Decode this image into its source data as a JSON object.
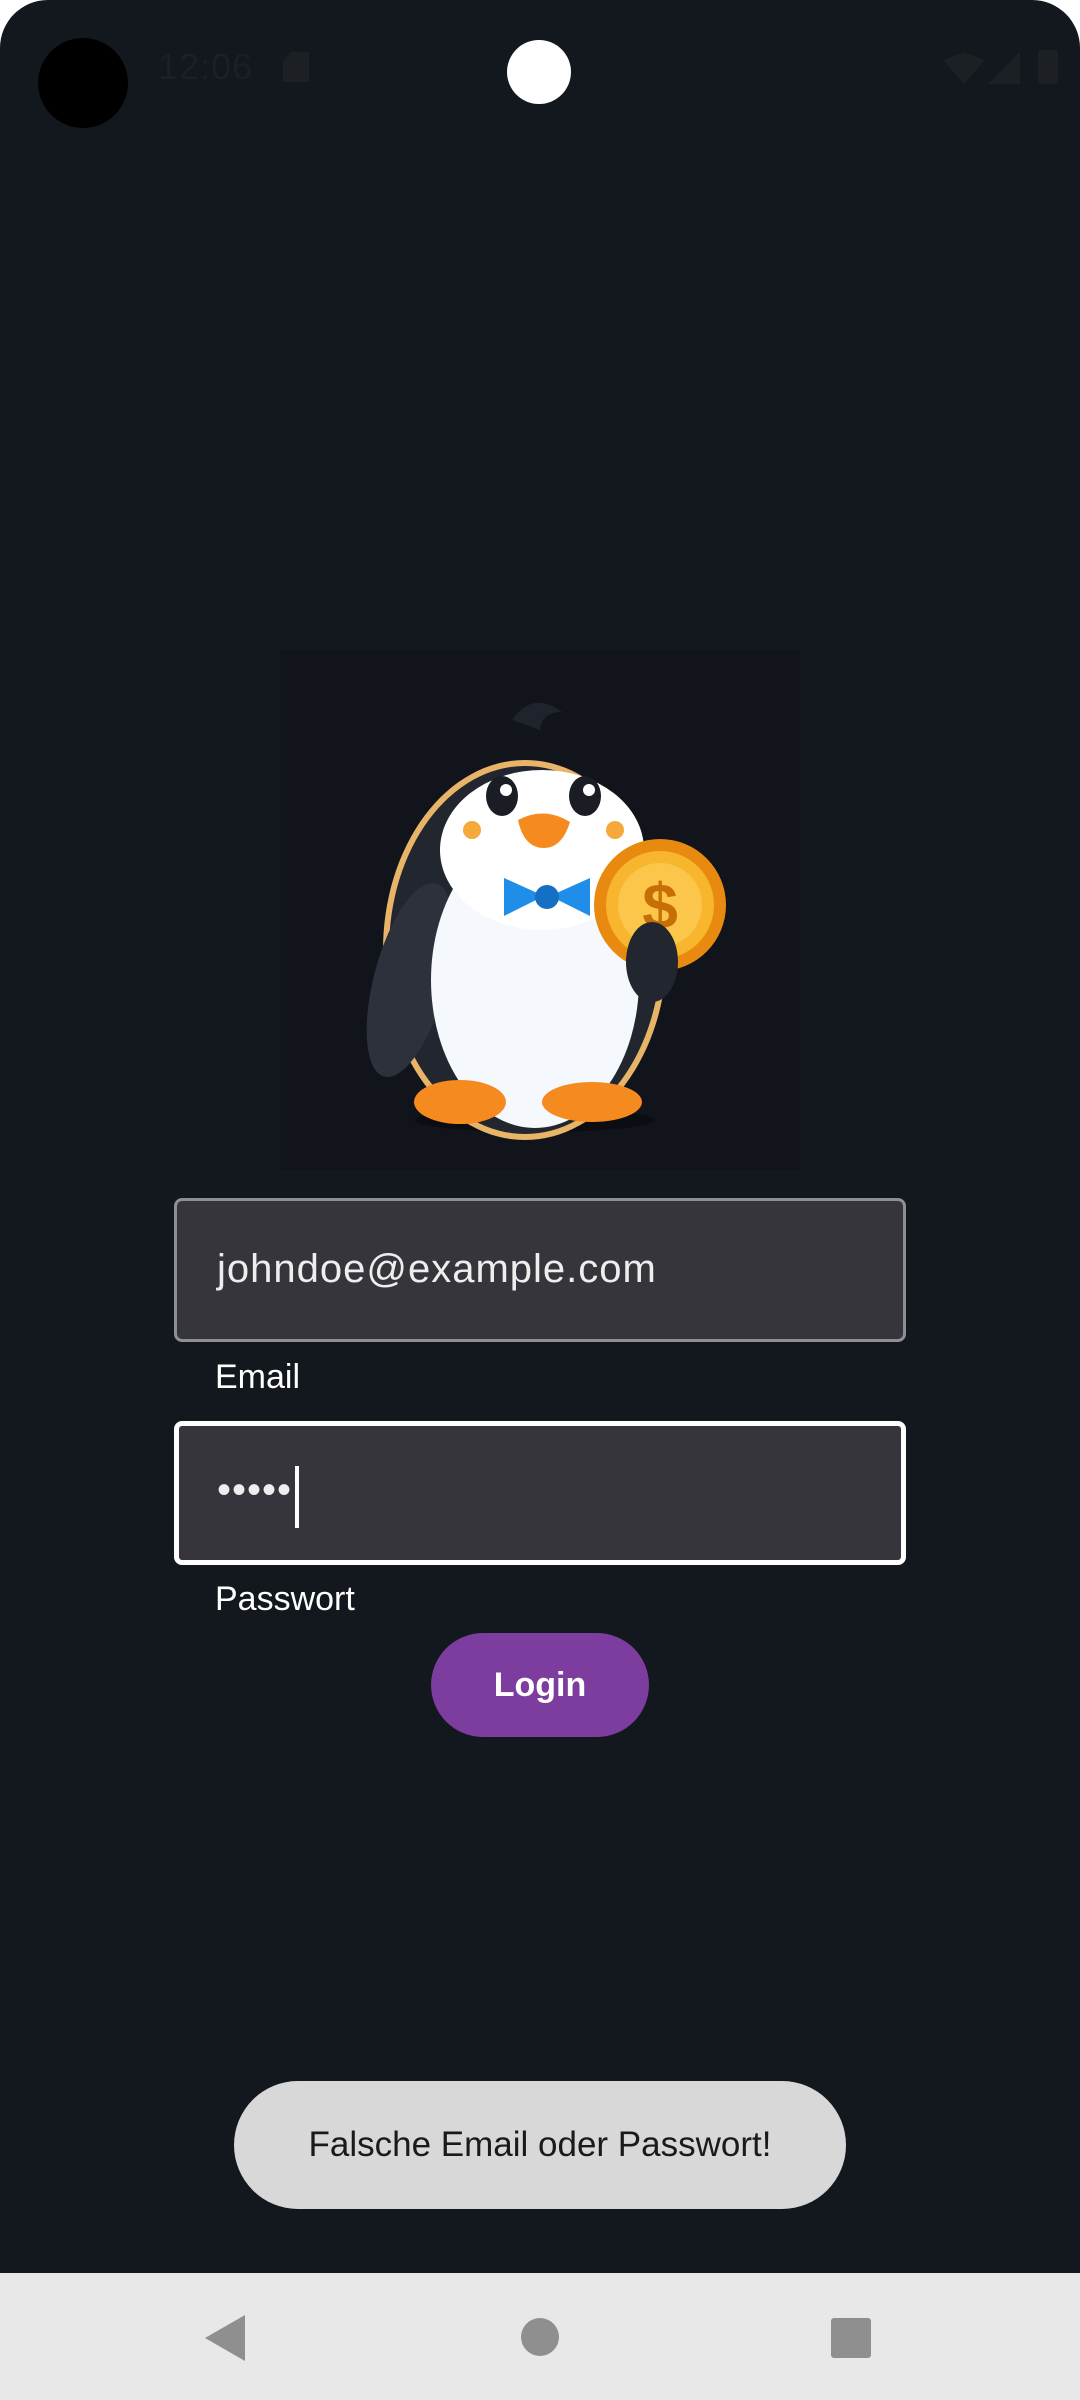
{
  "status_bar": {
    "time": "12:06",
    "icons": [
      "camera-hole",
      "sd-card-icon",
      "wifi-icon",
      "signal-icon",
      "battery-icon"
    ]
  },
  "logo": {
    "icon": "penguin-with-dollar-coin-icon"
  },
  "login_form": {
    "email": {
      "value": "johndoe@example.com",
      "label": "Email"
    },
    "password": {
      "value": "•••••",
      "label": "Passwort"
    },
    "login_button": "Login"
  },
  "toast": {
    "message": "Falsche Email oder Passwort!"
  },
  "colors": {
    "background": "#13171e",
    "field_background": "#36353c",
    "button": "#7d3d9e",
    "toast_background": "#d8d8d8",
    "nav_bar": "#e8e8e8"
  },
  "nav_bar": {
    "icons": [
      "back-icon",
      "home-icon",
      "recents-icon"
    ]
  }
}
